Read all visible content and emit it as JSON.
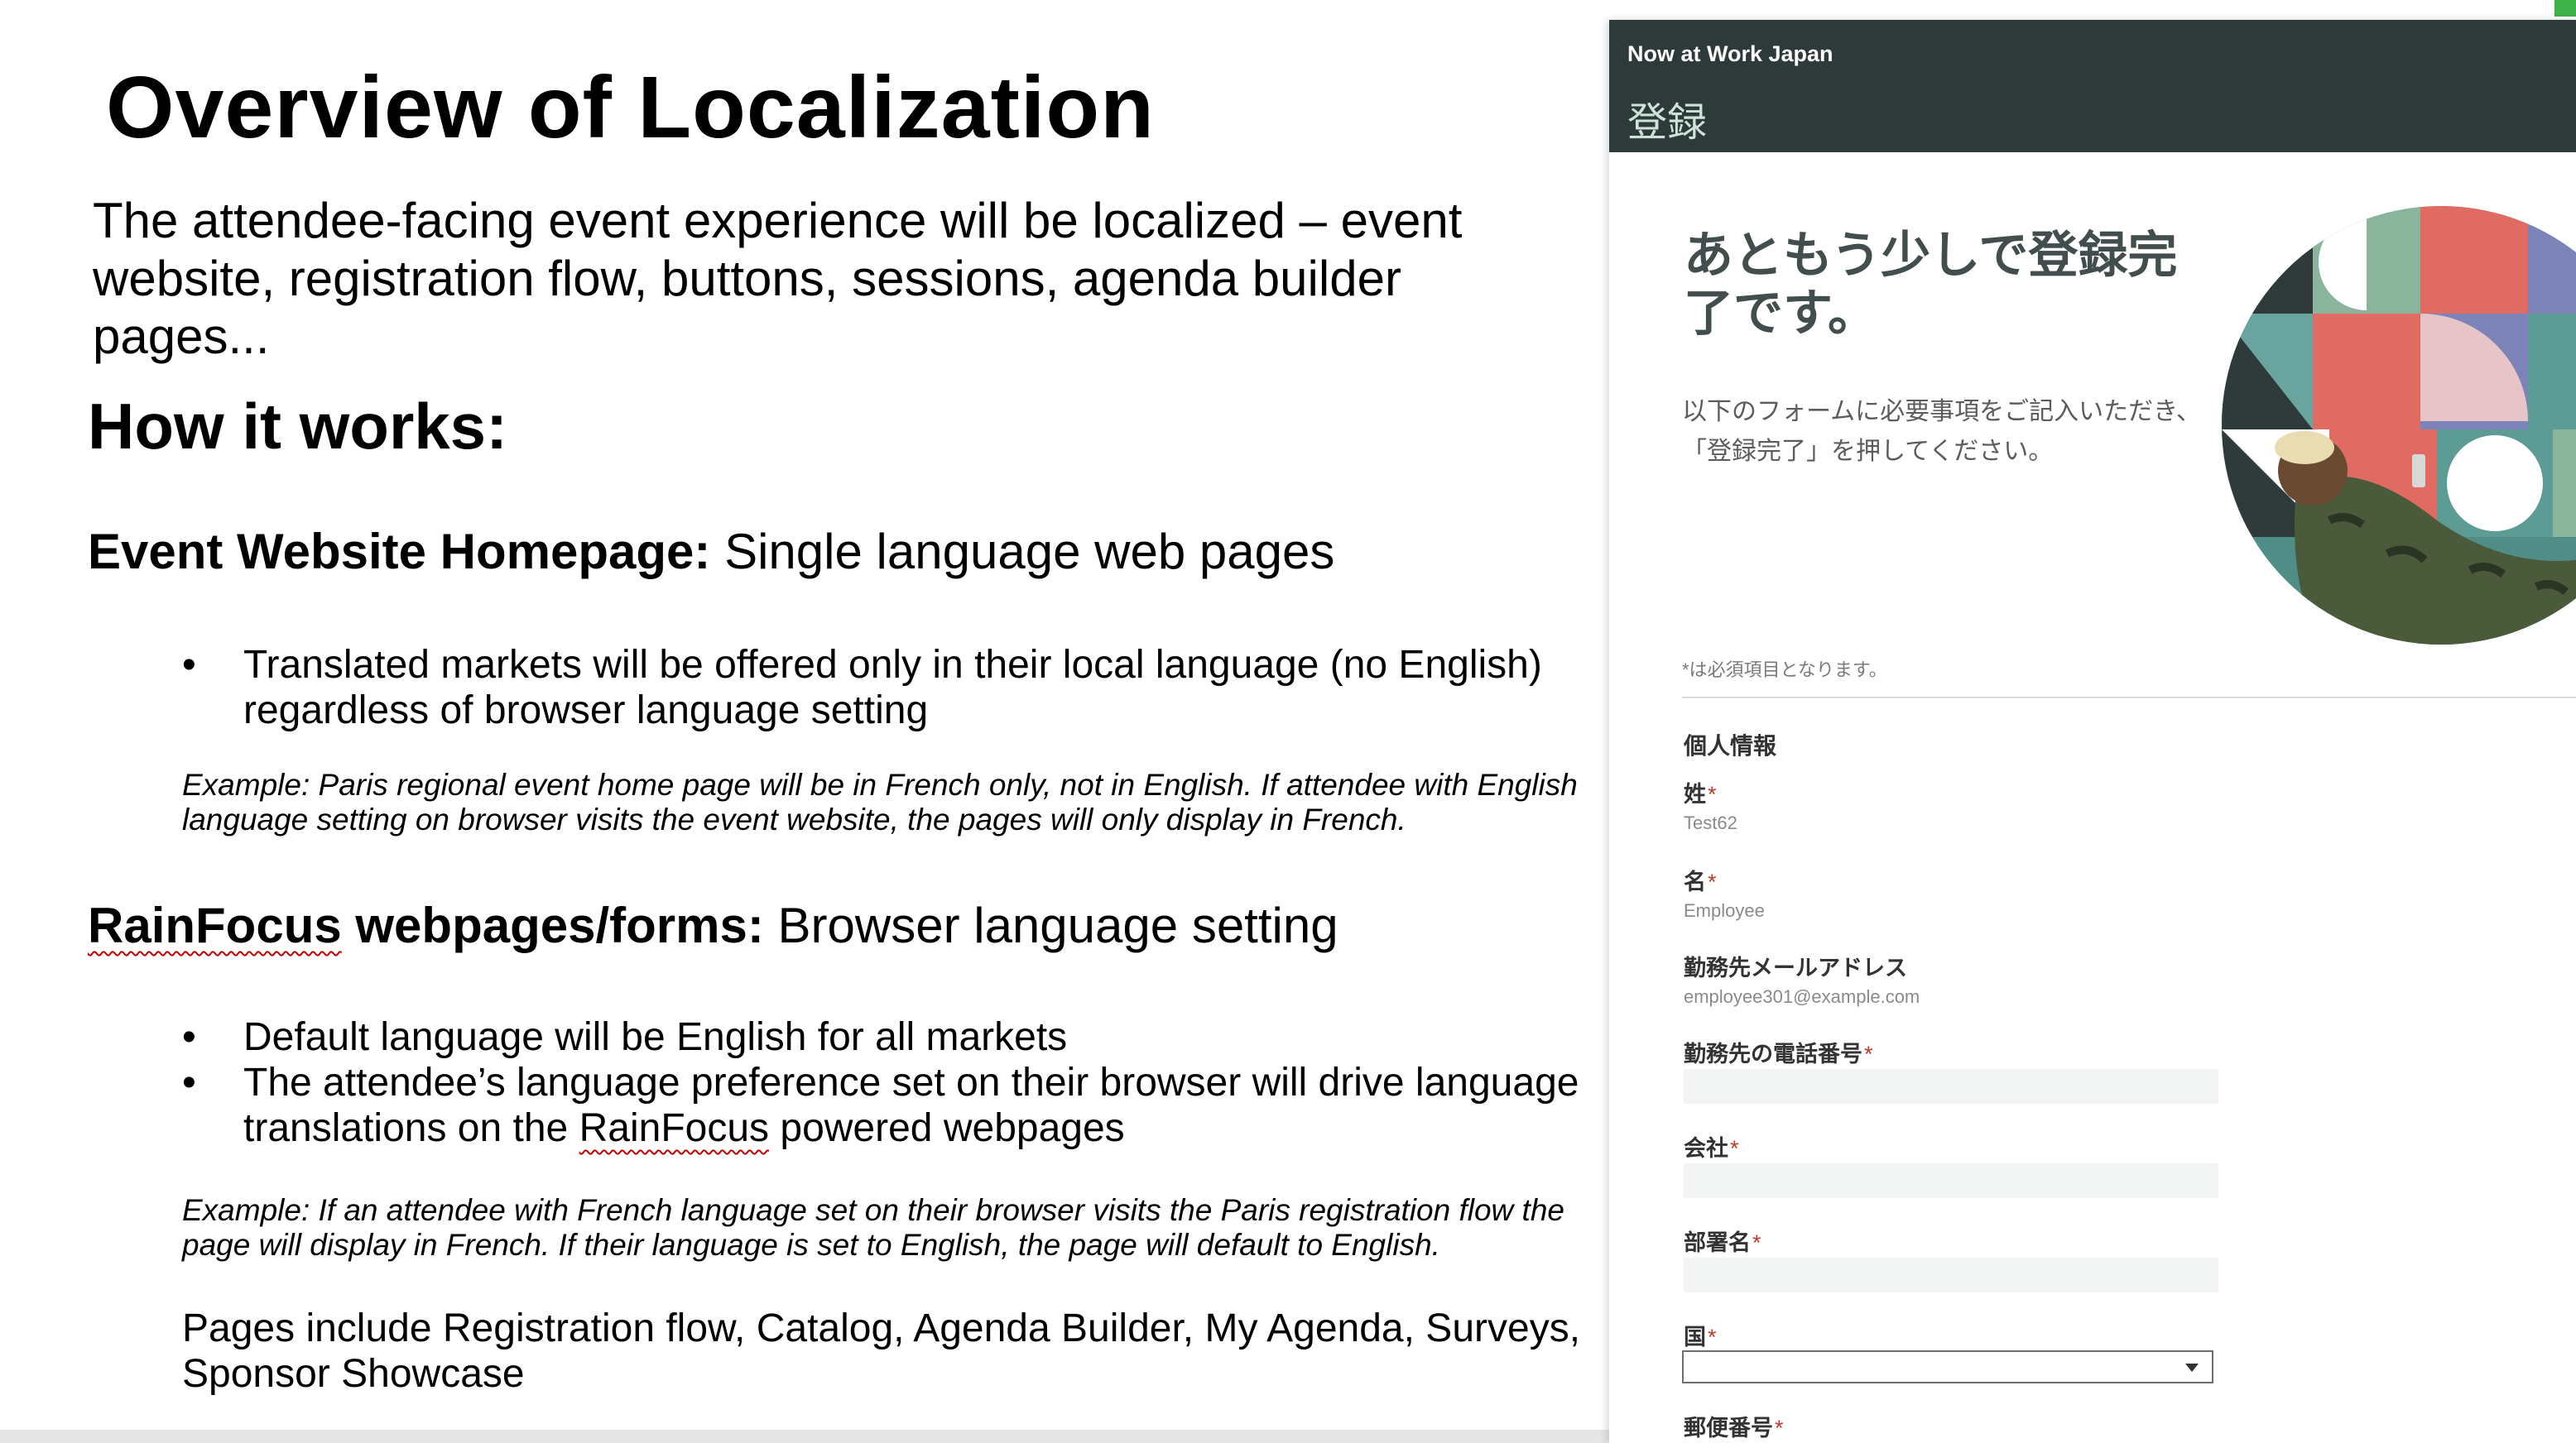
{
  "slide": {
    "title": "Overview of Localization",
    "intro": "The attendee-facing event experience will be localized – event website, registration flow, buttons, sessions, agenda builder pages...",
    "how_it_works": "How it works:",
    "section1": {
      "heading_bold": "Event Website Homepage:",
      "heading_rest": " Single language web pages",
      "bullets": [
        "Translated markets will be offered only in their local language (no English) regardless of browser language setting"
      ],
      "example": "Example: Paris regional event home page will be in French only, not in English. If attendee with English language setting on browser visits the event website, the pages will only display in French."
    },
    "section2": {
      "heading_brand": "RainFocus",
      "heading_bold": " webpages/forms:",
      "heading_rest": " Browser language setting",
      "bullet1": "Default language will be English for all markets",
      "bullet2_before": "The attendee’s language preference set on their browser will drive language translations on the ",
      "bullet2_brand": "RainFocus",
      "bullet2_after": " powered webpages",
      "example": "Example: If an attendee with French language set on their browser visits the Paris registration flow the page will display in French. If their language is set to English, the page will default to English."
    },
    "pages_note": "Pages include Registration flow, Catalog, Agenda Builder, My Agenda, Surveys, Sponsor Showcase",
    "bullet_glyph": "•"
  },
  "screenshot": {
    "brand": "Now at Work Japan",
    "page_title": "登録",
    "hero": "あともう少しで登録完了です。",
    "instructions": "以下のフォームに必要事項をご記入いただき、「登録完了」を押してください。",
    "required_note": "*は必須項目となります。",
    "section_label": "個人情報",
    "required_mark": "*",
    "fields": {
      "last_name": {
        "label": "姓",
        "value": "Test62"
      },
      "first_name": {
        "label": "名",
        "value": "Employee"
      },
      "email": {
        "label": "勤務先メールアドレス",
        "value": "employee301@example.com"
      },
      "phone": {
        "label": "勤務先の電話番号"
      },
      "company": {
        "label": "会社"
      },
      "department": {
        "label": "部署名"
      },
      "country": {
        "label": "国"
      },
      "postal": {
        "label": "郵便番号"
      }
    },
    "colors": {
      "header_bg": "#2e3939",
      "accent_red": "#c0392b",
      "hero_text": "#424d4d"
    }
  }
}
